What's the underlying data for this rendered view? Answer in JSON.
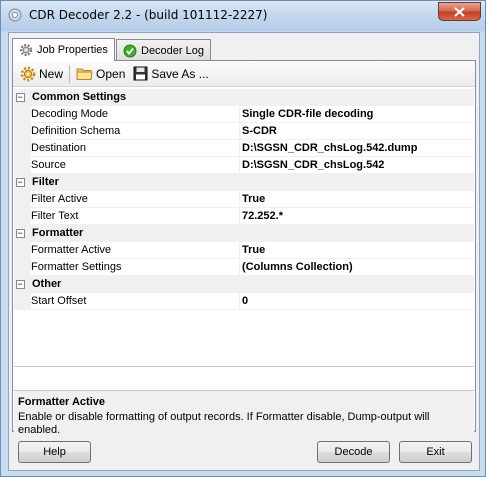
{
  "window": {
    "title": "CDR Decoder 2.2 - (build 101112-2227)"
  },
  "tabs": [
    {
      "label": "Job Properties",
      "icon": "gear-icon",
      "active": true
    },
    {
      "label": "Decoder Log",
      "icon": "green-check-icon",
      "active": false
    }
  ],
  "toolbar": {
    "new_label": "New",
    "open_label": "Open",
    "save_label": "Save As ..."
  },
  "grid": {
    "categories": [
      {
        "label": "Common Settings",
        "props": [
          {
            "name": "Decoding Mode",
            "value": "Single CDR-file decoding"
          },
          {
            "name": "Definition Schema",
            "value": "S-CDR"
          },
          {
            "name": "Destination",
            "value": "D:\\SGSN_CDR_chsLog.542.dump"
          },
          {
            "name": "Source",
            "value": "D:\\SGSN_CDR_chsLog.542"
          }
        ]
      },
      {
        "label": "Filter",
        "props": [
          {
            "name": "Filter Active",
            "value": "True"
          },
          {
            "name": "Filter Text",
            "value": "72.252.*"
          }
        ]
      },
      {
        "label": "Formatter",
        "props": [
          {
            "name": "Formatter Active",
            "value": "True"
          },
          {
            "name": "Formatter Settings",
            "value": "(Columns Collection)"
          }
        ]
      },
      {
        "label": "Other",
        "props": [
          {
            "name": "Start Offset",
            "value": "0"
          }
        ]
      }
    ]
  },
  "description": {
    "title": "Formatter Active",
    "text": "Enable or disable formatting of output records. If Formatter disable, Dump-output will enabled."
  },
  "buttons": {
    "help": "Help",
    "decode": "Decode",
    "exit": "Exit"
  },
  "colors": {
    "title_gradient_top": "#dbe8f6",
    "close_red": "#c0402a",
    "grid_gutter": "#f0f0f0"
  }
}
